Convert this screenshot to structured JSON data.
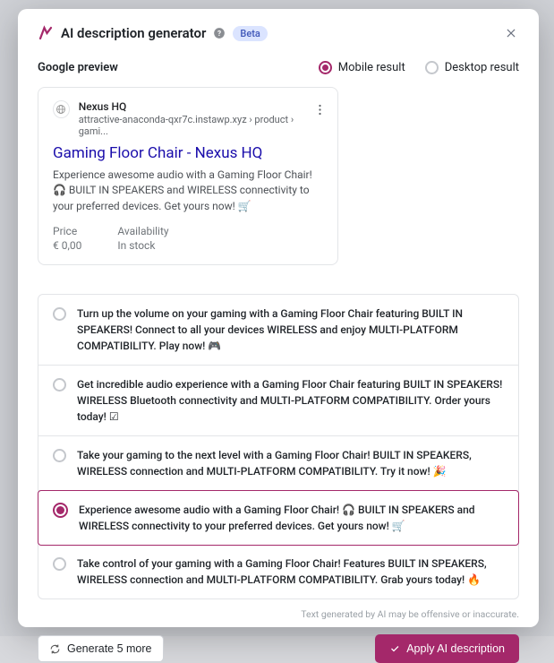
{
  "header": {
    "title": "AI description generator",
    "beta_label": "Beta"
  },
  "preview": {
    "section_label": "Google preview",
    "mobile_label": "Mobile result",
    "desktop_label": "Desktop result",
    "site_name": "Nexus HQ",
    "url": "attractive-anaconda-qxr7c.instawp.xyz › product › gami...",
    "title": "Gaming Floor Chair - Nexus HQ",
    "description": "Experience awesome audio with a Gaming Floor Chair! 🎧 BUILT IN SPEAKERS and WIRELESS connectivity to your preferred devices. Get yours now! 🛒",
    "price_label": "Price",
    "price_value": "€ 0,00",
    "avail_label": "Availability",
    "avail_value": "In stock"
  },
  "suggestions": [
    {
      "text": "Turn up the volume on your gaming with a Gaming Floor Chair featuring BUILT IN SPEAKERS! Connect to all your devices WIRELESS and enjoy MULTI-PLATFORM COMPATIBILITY. Play now! 🎮"
    },
    {
      "text": "Get incredible audio experience with a Gaming Floor Chair featuring BUILT IN SPEAKERS! WIRELESS Bluetooth connectivity and MULTI-PLATFORM COMPATIBILITY. Order yours today! ☑"
    },
    {
      "text": "Take your gaming to the next level with a Gaming Floor Chair! BUILT IN SPEAKERS, WIRELESS connection and MULTI-PLATFORM COMPATIBILITY. Try it now! 🎉"
    },
    {
      "text": "Experience awesome audio with a Gaming Floor Chair! 🎧 BUILT IN SPEAKERS and WIRELESS connectivity to your preferred devices. Get yours now! 🛒"
    },
    {
      "text": "Take control of your gaming with a Gaming Floor Chair! Features BUILT IN SPEAKERS, WIRELESS connection and MULTI-PLATFORM COMPATIBILITY. Grab yours today! 🔥"
    }
  ],
  "selected_index": 3,
  "disclaimer": "Text generated by AI may be offensive or inaccurate.",
  "footer": {
    "generate_label": "Generate 5 more",
    "apply_label": "Apply AI description"
  }
}
